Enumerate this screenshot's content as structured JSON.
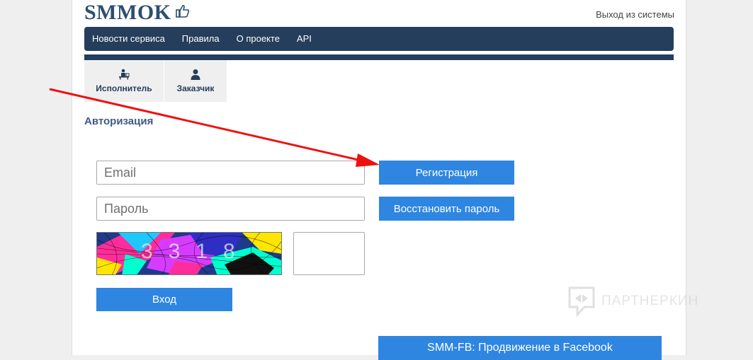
{
  "header": {
    "logo_text": "SMMOK",
    "logout_label": "Выход из системы"
  },
  "nav": {
    "items": [
      {
        "label": "Новости сервиса"
      },
      {
        "label": "Правила"
      },
      {
        "label": "О проекте"
      },
      {
        "label": "API"
      }
    ]
  },
  "role_tabs": [
    {
      "label": "Исполнитель",
      "icon": "worker-desk-icon"
    },
    {
      "label": "Заказчик",
      "icon": "user-icon"
    }
  ],
  "auth": {
    "title": "Авторизация",
    "email_placeholder": "Email",
    "password_placeholder": "Пароль",
    "captcha_text": "3318",
    "register_label": "Регистрация",
    "restore_label": "Восстановить пароль",
    "login_label": "Вход"
  },
  "promo": {
    "label": "SMM-FB: Продвижение в Facebook"
  },
  "watermark": {
    "text": "ПАРТНЕРКИН"
  },
  "colors": {
    "navbar": "#243e5b",
    "button": "#2e86e0",
    "annotation_arrow": "#ee1111"
  }
}
